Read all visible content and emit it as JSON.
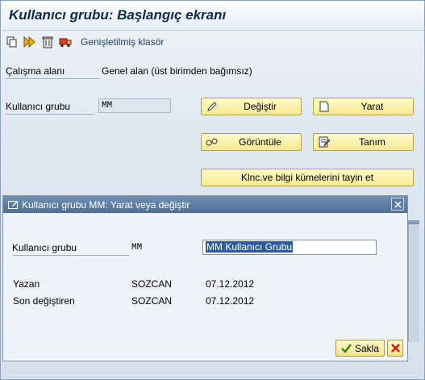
{
  "window": {
    "title": "Kullanıcı grubu: Başlangıç ekranı"
  },
  "toolbar": {
    "icons": [
      "copy-icon",
      "execute-icon",
      "delete-icon",
      "transport-icon"
    ],
    "extended_folder_label": "Genişletilmiş klasör"
  },
  "main": {
    "workspace_label": "Çalışma alanı",
    "workspace_value": "Genel alan (üst birimden bağımsız)",
    "user_group_label": "Kullanıcı grubu",
    "user_group_value": "MM",
    "buttons": {
      "change": "Değiştir",
      "create": "Yarat",
      "display": "Görüntüle",
      "definition": "Tanım",
      "assign": "Klnc.ve bilgi kümelerini tayin et"
    }
  },
  "dialog": {
    "title": "Kullanıcı grubu MM: Yarat veya değiştir",
    "user_group_label": "Kullanıcı grubu",
    "user_group_code": "MM",
    "user_group_text": "MM Kullanıcı Grubu",
    "author_label": "Yazan",
    "author_value": "SOZCAN",
    "author_date": "07.12.2012",
    "last_changed_label": "Son değiştiren",
    "last_changed_value": "SOZCAN",
    "last_changed_date": "07.12.2012",
    "save_label": "Sakla"
  },
  "colors": {
    "accent": "#4f6f95",
    "button_bg": "#f8e98c",
    "title_text": "#0d2a4a"
  }
}
